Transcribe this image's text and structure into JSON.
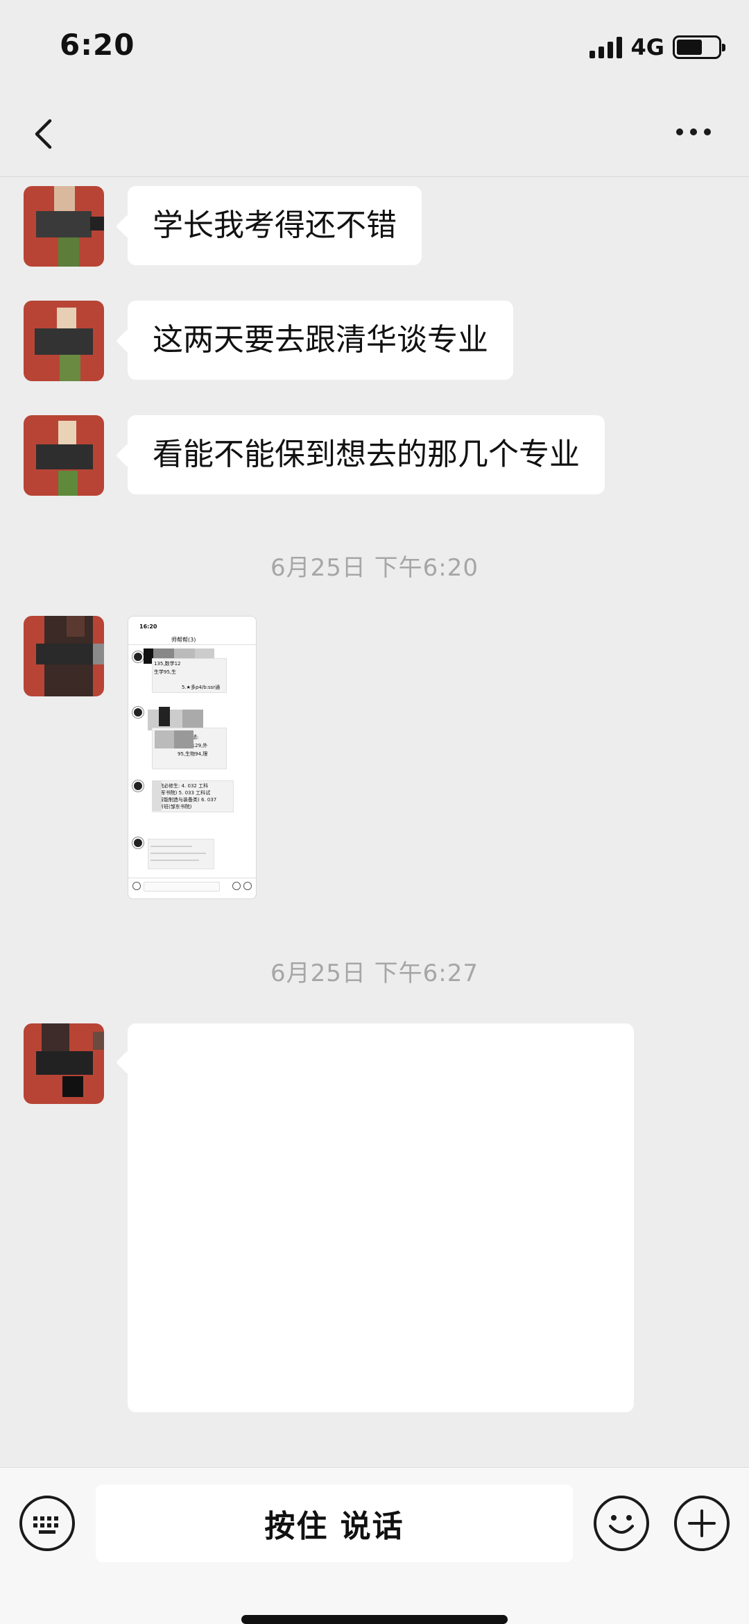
{
  "status_bar": {
    "time": "6:20",
    "network": "4G",
    "battery_level": 0.62
  },
  "nav": {
    "title": "",
    "back_icon": "chevron-left-icon",
    "more_icon": "more-dots-icon"
  },
  "messages": [
    {
      "type": "text",
      "text": "学长我考得还不错"
    },
    {
      "type": "text",
      "text": "这两天要去跟清华谈专业"
    },
    {
      "type": "text",
      "text": "看能不能保到想去的那几个专业"
    },
    {
      "type": "timestamp",
      "text": "6月25日 下午6:20"
    },
    {
      "type": "image",
      "thumbnail": {
        "time": "16:20",
        "title": "师帮帮(3)",
        "lines": [
          "135,数学12",
          "生学95,生",
          "5.★多p4/b:ssr通",
          "成绩:",
          "5,数学129,外",
          "95,生物94,理",
          "学院必修生: 4. 032 工科",
          "(求军书院) 5. 033 工科试",
          "超智能制造与装备类) 6. 037",
          "创新班(邹东书院)"
        ]
      }
    },
    {
      "type": "timestamp",
      "text": "6月25日 下午6:27"
    },
    {
      "type": "text",
      "text": ""
    }
  ],
  "input_bar": {
    "keyboard_icon": "keyboard-icon",
    "voice_label": "按住 说话",
    "emoji_icon": "emoji-icon",
    "add_icon": "plus-circle-icon"
  },
  "colors": {
    "background": "#ededed",
    "bubble": "#ffffff",
    "avatar": "#b84435",
    "timestamp": "#a6a6a6"
  }
}
